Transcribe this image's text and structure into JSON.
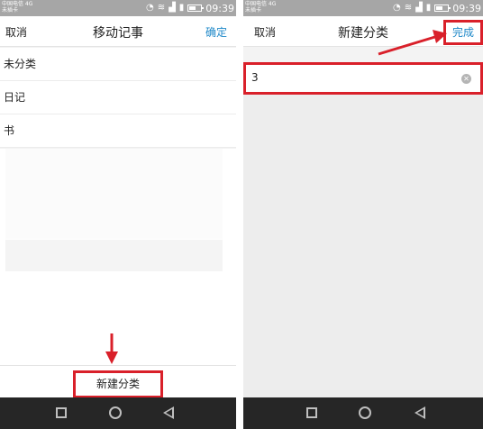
{
  "status_bar": {
    "carrier_line1": "中国电信 4G",
    "carrier_line2": "未插卡",
    "time": "09:39",
    "icons": [
      "notification-icon",
      "sim-icon",
      "wifi-icon",
      "signal-icon",
      "battery-icon"
    ]
  },
  "left_screen": {
    "header": {
      "cancel_label": "取消",
      "title": "移动记事",
      "confirm_label": "确定"
    },
    "categories": [
      {
        "label": "未分类"
      },
      {
        "label": "日记"
      },
      {
        "label": "书"
      }
    ],
    "new_category_label": "新建分类"
  },
  "right_screen": {
    "header": {
      "cancel_label": "取消",
      "title": "新建分类",
      "done_label": "完成"
    },
    "input": {
      "value": "3",
      "clear_icon": "clear-icon"
    }
  },
  "nav_bar": {
    "icons": [
      "recent-apps-icon",
      "home-icon",
      "back-icon"
    ]
  },
  "colors": {
    "accent": "#1e88c8",
    "highlight": "#d9202a",
    "status_bar": "#a6a6a6",
    "nav_bar": "#262626"
  }
}
